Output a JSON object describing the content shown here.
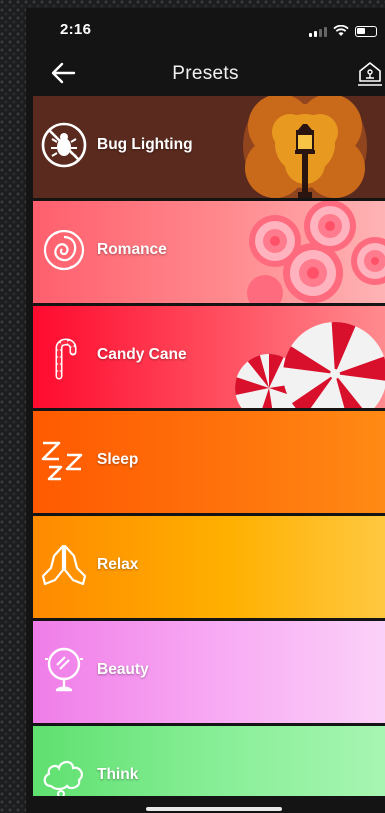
{
  "status_bar": {
    "time": "2:16"
  },
  "nav": {
    "title": "Presets"
  },
  "presets": [
    {
      "label": "Bug Lighting",
      "icon": "bug-icon"
    },
    {
      "label": "Romance",
      "icon": "rose-icon"
    },
    {
      "label": "Candy Cane",
      "icon": "candy-cane-icon"
    },
    {
      "label": "Sleep",
      "icon": "zzz-icon"
    },
    {
      "label": "Relax",
      "icon": "praying-hands-icon"
    },
    {
      "label": "Beauty",
      "icon": "mirror-icon"
    },
    {
      "label": "Think",
      "icon": "thought-bubble-icon"
    }
  ],
  "colors": {
    "bug_lighting": "#5a2a1e",
    "romance": "#ff7a80",
    "candy_cane": "#ff1a3a",
    "sleep": "#ff6a08",
    "relax": "#ffb000",
    "beauty": "#f5a0f0",
    "think": "#80eb90"
  }
}
